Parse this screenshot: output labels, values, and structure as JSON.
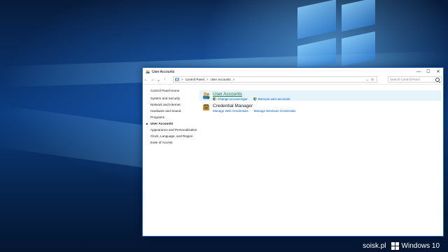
{
  "window": {
    "title": "User Accounts",
    "controls": {
      "minimize": "—",
      "maximize": "☐",
      "close": "✕"
    }
  },
  "nav": {
    "back": "←",
    "forward": "→",
    "recent": "⌄",
    "up": "↑"
  },
  "address": {
    "segments": [
      "Control Panel",
      "User Accounts"
    ],
    "separator": ">",
    "dropdown": "⌄",
    "refresh": "↻"
  },
  "search": {
    "placeholder": "Search Control Panel"
  },
  "sidebar": {
    "home": "Control Panel Home",
    "items": [
      {
        "label": "System and Security",
        "current": false
      },
      {
        "label": "Network and Internet",
        "current": false
      },
      {
        "label": "Hardware and Sound",
        "current": false
      },
      {
        "label": "Programs",
        "current": false
      },
      {
        "label": "User Accounts",
        "current": true
      },
      {
        "label": "Appearance and Personalization",
        "current": false
      },
      {
        "label": "Clock, Language, and Region",
        "current": false
      },
      {
        "label": "Ease of Access",
        "current": false
      }
    ]
  },
  "categories": [
    {
      "heading": "User Accounts",
      "icon": "user-accounts-icon",
      "links": [
        "Change account type",
        "Remove user accounts"
      ]
    },
    {
      "heading": "Credential Manager",
      "icon": "credential-manager-icon",
      "links": [
        "Manage Web Credentials",
        "Manage Windows Credentials"
      ]
    }
  ],
  "watermark": {
    "site": "soisk.pl",
    "product": "Windows 10"
  },
  "colors": {
    "link": "#0066cc",
    "category_heading": "#1e7145",
    "highlight": "#e5f3fb",
    "window_border": "#1b6ac9"
  }
}
